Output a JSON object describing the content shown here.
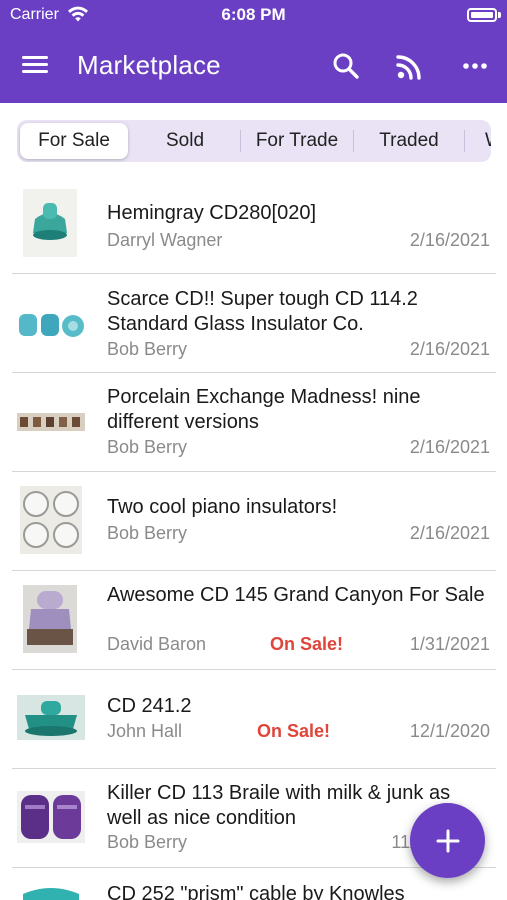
{
  "status_bar": {
    "carrier": "Carrier",
    "time": "6:08 PM"
  },
  "app_bar": {
    "title": "Marketplace",
    "icons": [
      "menu-icon",
      "search-icon",
      "rss-icon",
      "more-icon"
    ]
  },
  "tabs": [
    {
      "label": "For Sale",
      "selected": true
    },
    {
      "label": "Sold",
      "selected": false
    },
    {
      "label": "For Trade",
      "selected": false
    },
    {
      "label": "Traded",
      "selected": false
    },
    {
      "label": "W",
      "selected": false
    }
  ],
  "listings": [
    {
      "title": "Hemingray CD280[020]",
      "author": "Darryl Wagner",
      "date": "2/16/2021",
      "sale": ""
    },
    {
      "title": "Scarce CD!! Super tough CD 114.2 Standard Glass Insulator Co.",
      "author": "Bob Berry",
      "date": "2/16/2021",
      "sale": ""
    },
    {
      "title": "Porcelain Exchange Madness! nine different versions",
      "author": "Bob Berry",
      "date": "2/16/2021",
      "sale": ""
    },
    {
      "title": "Two cool piano insulators!",
      "author": "Bob Berry",
      "date": "2/16/2021",
      "sale": ""
    },
    {
      "title": "Awesome CD 145 Grand Canyon For Sale",
      "author": "David Baron",
      "date": "1/31/2021",
      "sale": "On Sale!"
    },
    {
      "title": "CD 241.2",
      "author": "John Hall",
      "date": "12/1/2020",
      "sale": "On Sale!"
    },
    {
      "title": "Killer CD 113 Braile with milk & junk as well as nice condition",
      "author": "Bob Berry",
      "date": "11/",
      "sale": ""
    },
    {
      "title": "CD 252 \"prism\" cable by Knowles",
      "author": "",
      "date": "",
      "sale": ""
    }
  ],
  "fab": {
    "icon": "plus-icon"
  },
  "colors": {
    "primary": "#6a3fc4",
    "sale": "#e0453a",
    "secondary_text": "#8a8a8a",
    "tab_background": "#e9e3f5"
  }
}
